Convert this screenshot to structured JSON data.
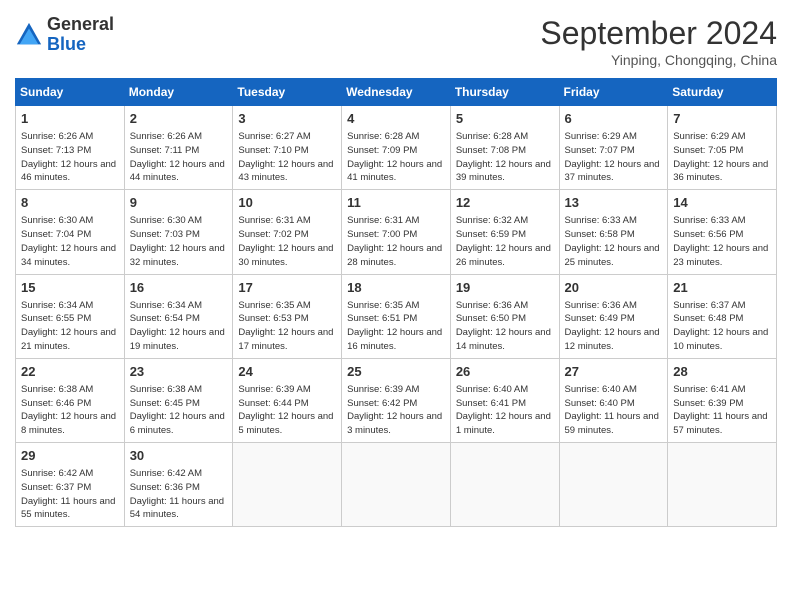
{
  "header": {
    "logo_line1": "General",
    "logo_line2": "Blue",
    "month": "September 2024",
    "location": "Yinping, Chongqing, China"
  },
  "days_of_week": [
    "Sunday",
    "Monday",
    "Tuesday",
    "Wednesday",
    "Thursday",
    "Friday",
    "Saturday"
  ],
  "weeks": [
    [
      {
        "num": "1",
        "rise": "6:26 AM",
        "set": "7:13 PM",
        "hours": "12 hours and 46 minutes."
      },
      {
        "num": "2",
        "rise": "6:26 AM",
        "set": "7:11 PM",
        "hours": "12 hours and 44 minutes."
      },
      {
        "num": "3",
        "rise": "6:27 AM",
        "set": "7:10 PM",
        "hours": "12 hours and 43 minutes."
      },
      {
        "num": "4",
        "rise": "6:28 AM",
        "set": "7:09 PM",
        "hours": "12 hours and 41 minutes."
      },
      {
        "num": "5",
        "rise": "6:28 AM",
        "set": "7:08 PM",
        "hours": "12 hours and 39 minutes."
      },
      {
        "num": "6",
        "rise": "6:29 AM",
        "set": "7:07 PM",
        "hours": "12 hours and 37 minutes."
      },
      {
        "num": "7",
        "rise": "6:29 AM",
        "set": "7:05 PM",
        "hours": "12 hours and 36 minutes."
      }
    ],
    [
      {
        "num": "8",
        "rise": "6:30 AM",
        "set": "7:04 PM",
        "hours": "12 hours and 34 minutes."
      },
      {
        "num": "9",
        "rise": "6:30 AM",
        "set": "7:03 PM",
        "hours": "12 hours and 32 minutes."
      },
      {
        "num": "10",
        "rise": "6:31 AM",
        "set": "7:02 PM",
        "hours": "12 hours and 30 minutes."
      },
      {
        "num": "11",
        "rise": "6:31 AM",
        "set": "7:00 PM",
        "hours": "12 hours and 28 minutes."
      },
      {
        "num": "12",
        "rise": "6:32 AM",
        "set": "6:59 PM",
        "hours": "12 hours and 26 minutes."
      },
      {
        "num": "13",
        "rise": "6:33 AM",
        "set": "6:58 PM",
        "hours": "12 hours and 25 minutes."
      },
      {
        "num": "14",
        "rise": "6:33 AM",
        "set": "6:56 PM",
        "hours": "12 hours and 23 minutes."
      }
    ],
    [
      {
        "num": "15",
        "rise": "6:34 AM",
        "set": "6:55 PM",
        "hours": "12 hours and 21 minutes."
      },
      {
        "num": "16",
        "rise": "6:34 AM",
        "set": "6:54 PM",
        "hours": "12 hours and 19 minutes."
      },
      {
        "num": "17",
        "rise": "6:35 AM",
        "set": "6:53 PM",
        "hours": "12 hours and 17 minutes."
      },
      {
        "num": "18",
        "rise": "6:35 AM",
        "set": "6:51 PM",
        "hours": "12 hours and 16 minutes."
      },
      {
        "num": "19",
        "rise": "6:36 AM",
        "set": "6:50 PM",
        "hours": "12 hours and 14 minutes."
      },
      {
        "num": "20",
        "rise": "6:36 AM",
        "set": "6:49 PM",
        "hours": "12 hours and 12 minutes."
      },
      {
        "num": "21",
        "rise": "6:37 AM",
        "set": "6:48 PM",
        "hours": "12 hours and 10 minutes."
      }
    ],
    [
      {
        "num": "22",
        "rise": "6:38 AM",
        "set": "6:46 PM",
        "hours": "12 hours and 8 minutes."
      },
      {
        "num": "23",
        "rise": "6:38 AM",
        "set": "6:45 PM",
        "hours": "12 hours and 6 minutes."
      },
      {
        "num": "24",
        "rise": "6:39 AM",
        "set": "6:44 PM",
        "hours": "12 hours and 5 minutes."
      },
      {
        "num": "25",
        "rise": "6:39 AM",
        "set": "6:42 PM",
        "hours": "12 hours and 3 minutes."
      },
      {
        "num": "26",
        "rise": "6:40 AM",
        "set": "6:41 PM",
        "hours": "12 hours and 1 minute."
      },
      {
        "num": "27",
        "rise": "6:40 AM",
        "set": "6:40 PM",
        "hours": "11 hours and 59 minutes."
      },
      {
        "num": "28",
        "rise": "6:41 AM",
        "set": "6:39 PM",
        "hours": "11 hours and 57 minutes."
      }
    ],
    [
      {
        "num": "29",
        "rise": "6:42 AM",
        "set": "6:37 PM",
        "hours": "11 hours and 55 minutes."
      },
      {
        "num": "30",
        "rise": "6:42 AM",
        "set": "6:36 PM",
        "hours": "11 hours and 54 minutes."
      },
      null,
      null,
      null,
      null,
      null
    ]
  ],
  "labels": {
    "sunrise": "Sunrise:",
    "sunset": "Sunset:",
    "daylight": "Daylight:"
  }
}
